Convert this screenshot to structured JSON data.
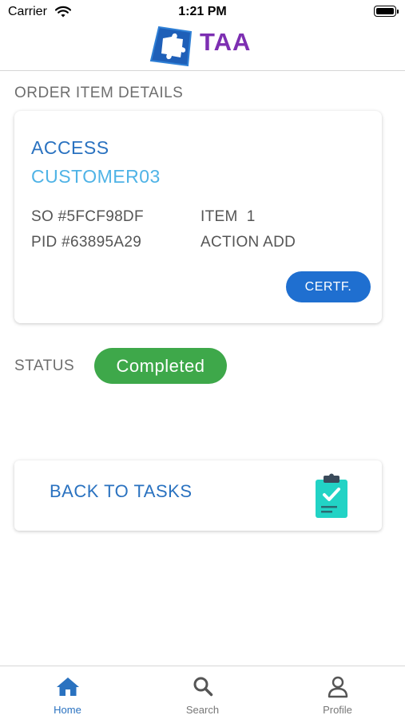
{
  "status_bar": {
    "carrier": "Carrier",
    "time": "1:21 PM"
  },
  "header": {
    "brand": "TAA",
    "logo": "puzzle-logo-icon"
  },
  "section_title": "ORDER ITEM DETAILS",
  "order_card": {
    "category": "ACCESS",
    "customer": "CUSTOMER03",
    "so": "SO #5FCF98DF",
    "item": "ITEM  1",
    "pid": "PID #63895A29",
    "action": "ACTION ADD",
    "certf_label": "CERTF."
  },
  "status": {
    "label": "STATUS",
    "value": "Completed",
    "color": "#3ea84a"
  },
  "back_to_tasks": {
    "label": "BACK TO TASKS",
    "icon": "clipboard-check-icon"
  },
  "tab_bar": {
    "items": [
      {
        "label": "Home",
        "icon": "home-icon",
        "active": true
      },
      {
        "label": "Search",
        "icon": "search-icon",
        "active": false
      },
      {
        "label": "Profile",
        "icon": "profile-icon",
        "active": false
      }
    ]
  },
  "colors": {
    "accent": "#2a72c0",
    "brand": "#7d2fb2",
    "button": "#1f6fd0",
    "customer": "#4fb3e6"
  }
}
